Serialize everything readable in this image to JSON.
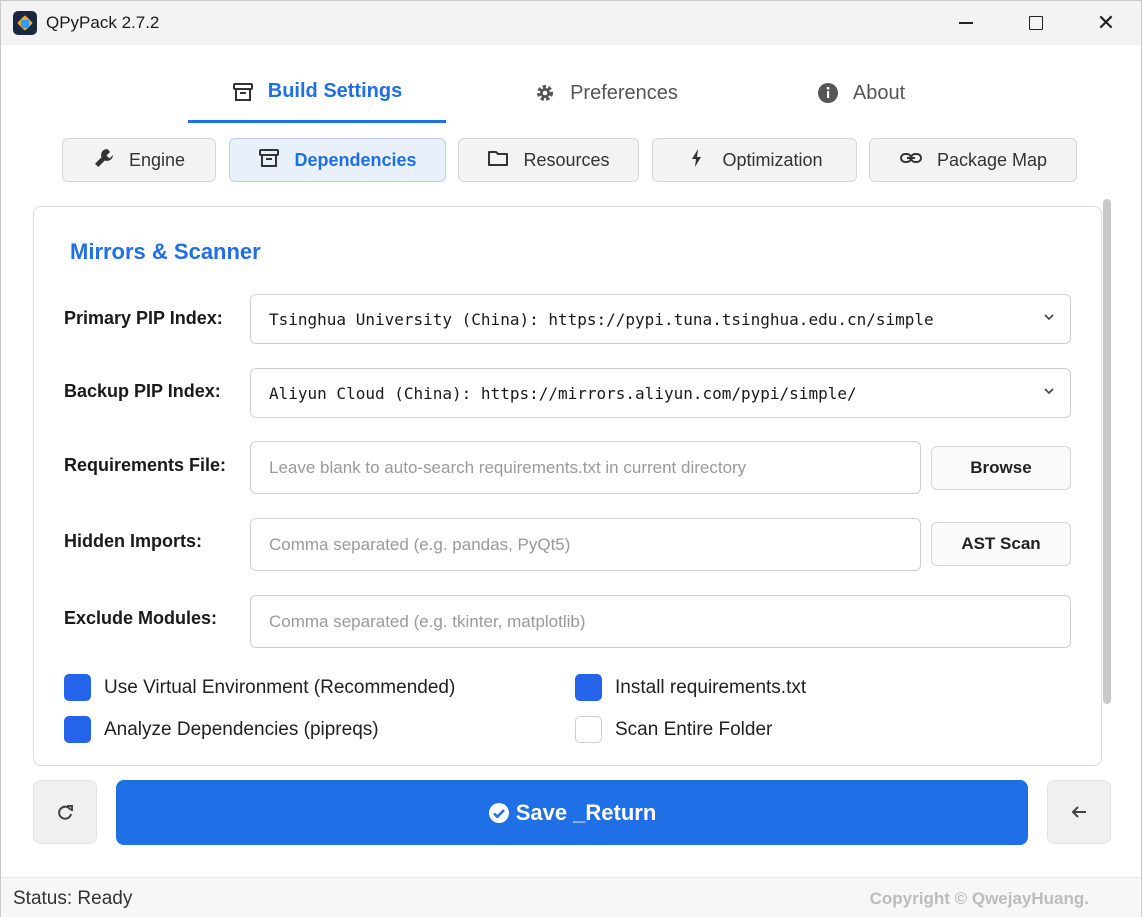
{
  "window": {
    "title": "QPyPack 2.7.2",
    "controls": {
      "minimize": "minimize",
      "maximize": "maximize",
      "close": "✕"
    }
  },
  "main_tabs": [
    {
      "label": "Build Settings",
      "icon": "archive-icon",
      "active": true
    },
    {
      "label": "Preferences",
      "icon": "gear-icon",
      "active": false
    },
    {
      "label": "About",
      "icon": "info-icon",
      "active": false
    }
  ],
  "sub_tabs": [
    {
      "label": "Engine",
      "icon": "wrench-icon",
      "active": false
    },
    {
      "label": "Dependencies",
      "icon": "archive-icon",
      "active": true
    },
    {
      "label": "Resources",
      "icon": "folder-icon",
      "active": false
    },
    {
      "label": "Optimization",
      "icon": "bolt-icon",
      "active": false
    },
    {
      "label": "Package Map",
      "icon": "link-icon",
      "active": false
    }
  ],
  "section": {
    "title": "Mirrors & Scanner"
  },
  "fields": {
    "primary_index": {
      "label": "Primary PIP Index:",
      "value": "Tsinghua University (China): https://pypi.tuna.tsinghua.edu.cn/simple"
    },
    "backup_index": {
      "label": "Backup PIP Index:",
      "value": "Aliyun Cloud (China): https://mirrors.aliyun.com/pypi/simple/"
    },
    "requirements_file": {
      "label": "Requirements File:",
      "placeholder": "Leave blank to auto-search requirements.txt in current directory",
      "value": "",
      "button": "Browse"
    },
    "hidden_imports": {
      "label": "Hidden Imports:",
      "placeholder": "Comma separated (e.g. pandas, PyQt5)",
      "value": "",
      "button": "AST Scan"
    },
    "exclude_modules": {
      "label": "Exclude Modules:",
      "placeholder": "Comma separated (e.g. tkinter, matplotlib)",
      "value": ""
    }
  },
  "checkboxes": [
    {
      "label": "Use Virtual Environment (Recommended)",
      "checked": true
    },
    {
      "label": "Install requirements.txt",
      "checked": true
    },
    {
      "label": "Analyze Dependencies (pipreqs)",
      "checked": true
    },
    {
      "label": "Scan Entire Folder",
      "checked": false
    }
  ],
  "actions": {
    "save_label": "Save _Return",
    "refresh_icon": "refresh-icon",
    "back_icon": "arrow-left-icon"
  },
  "status": {
    "text": "Status: Ready",
    "copyright": "Copyright © QwejayHuang."
  },
  "colors": {
    "accent": "#1f6fe6",
    "checkbox_on": "#2563eb"
  }
}
